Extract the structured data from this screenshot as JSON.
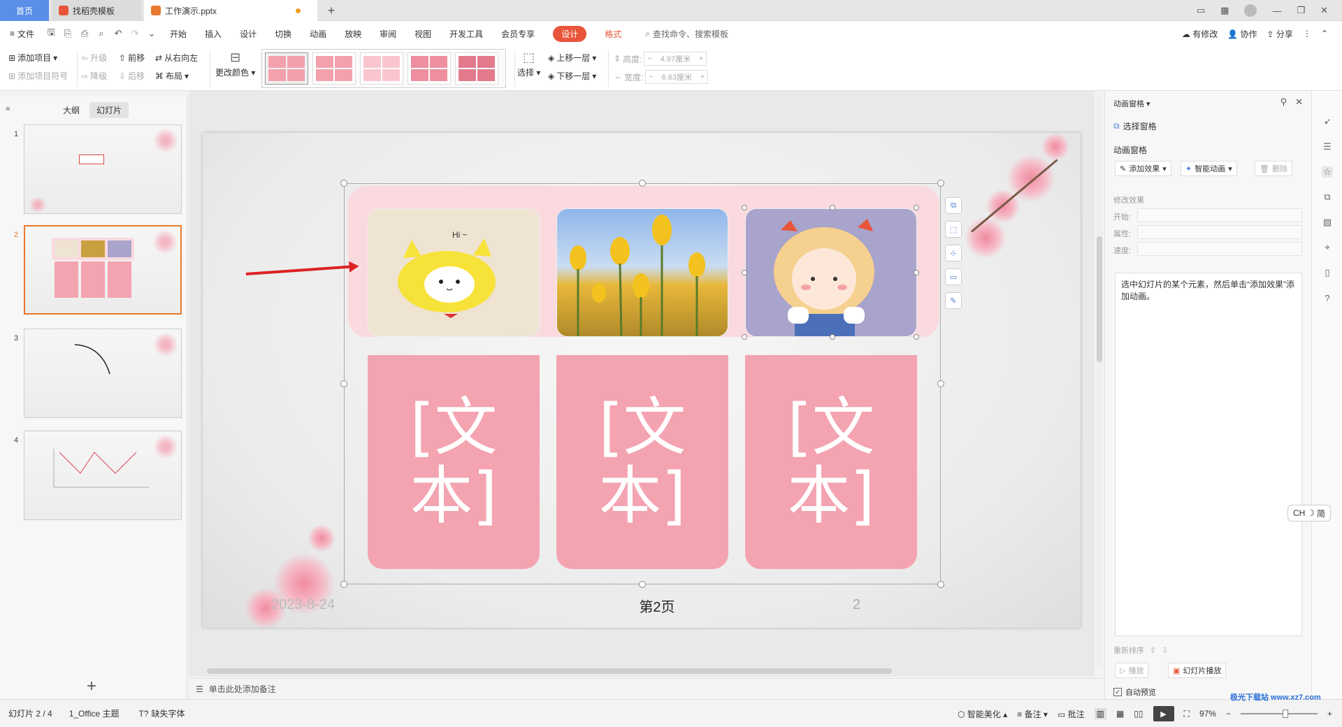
{
  "tabs": {
    "home": "首页",
    "template": "找稻壳模板",
    "document": "工作演示.pptx",
    "add": "+"
  },
  "menubar": {
    "file": "文件",
    "items": [
      "开始",
      "插入",
      "设计",
      "切换",
      "动画",
      "放映",
      "审阅",
      "视图",
      "开发工具",
      "会员专享"
    ],
    "active": "设计",
    "format": "格式",
    "search": "查找命令、搜索模板",
    "right": {
      "modified": "有修改",
      "collab": "协作",
      "share": "分享"
    }
  },
  "ribbon": {
    "add_item": "添加项目",
    "add_bullet": "添加项目符号",
    "promote": "升级",
    "demote": "降级",
    "forward": "前移",
    "backward": "后移",
    "right_to_left": "从右向左",
    "layout": "布局",
    "change_color": "更改颜色",
    "select": "选择",
    "bring_forward": "上移一层",
    "send_backward": "下移一层",
    "height_label": "高度:",
    "height_value": "4.97厘米",
    "width_label": "宽度:",
    "width_value": "6.63厘米",
    "accent": "#f4a0ad"
  },
  "leftpanel": {
    "tab_outline": "大纲",
    "tab_slides": "幻灯片",
    "slides": [
      "1",
      "2",
      "3",
      "4"
    ],
    "active_slide": "2",
    "add": "+"
  },
  "slide": {
    "card_text": "[文\n本]",
    "card_texts": [
      "[文本]",
      "[文本]",
      "[文本]"
    ],
    "date": "2023-8-24",
    "page_label": "第2页",
    "page_num": "2",
    "hi_text": "Hi ~"
  },
  "notes": {
    "placeholder": "单击此处添加备注"
  },
  "animation_pane": {
    "title": "动画窗格",
    "select_pane": "选择窗格",
    "section": "动画窗格",
    "add_effect": "添加效果",
    "smart_anim": "智能动画",
    "delete": "删除",
    "modify": "修改效果",
    "start": "开始:",
    "property": "属性:",
    "speed": "速度:",
    "hint": "选中幻灯片的某个元素，然后单击“添加效果”添加动画。",
    "reorder": "重新排序",
    "play": "播放",
    "slideshow": "幻灯片播放",
    "autopreview": "自动预览"
  },
  "ime": {
    "label": "CH",
    "mode": "简"
  },
  "statusbar": {
    "slide": "幻灯片 2 / 4",
    "theme": "1_Office 主题",
    "missing_fonts": "缺失字体",
    "beautify": "智能美化",
    "notes": "备注",
    "comments": "批注",
    "zoom": "97%"
  },
  "watermark": "极光下载站 www.xz7.com"
}
